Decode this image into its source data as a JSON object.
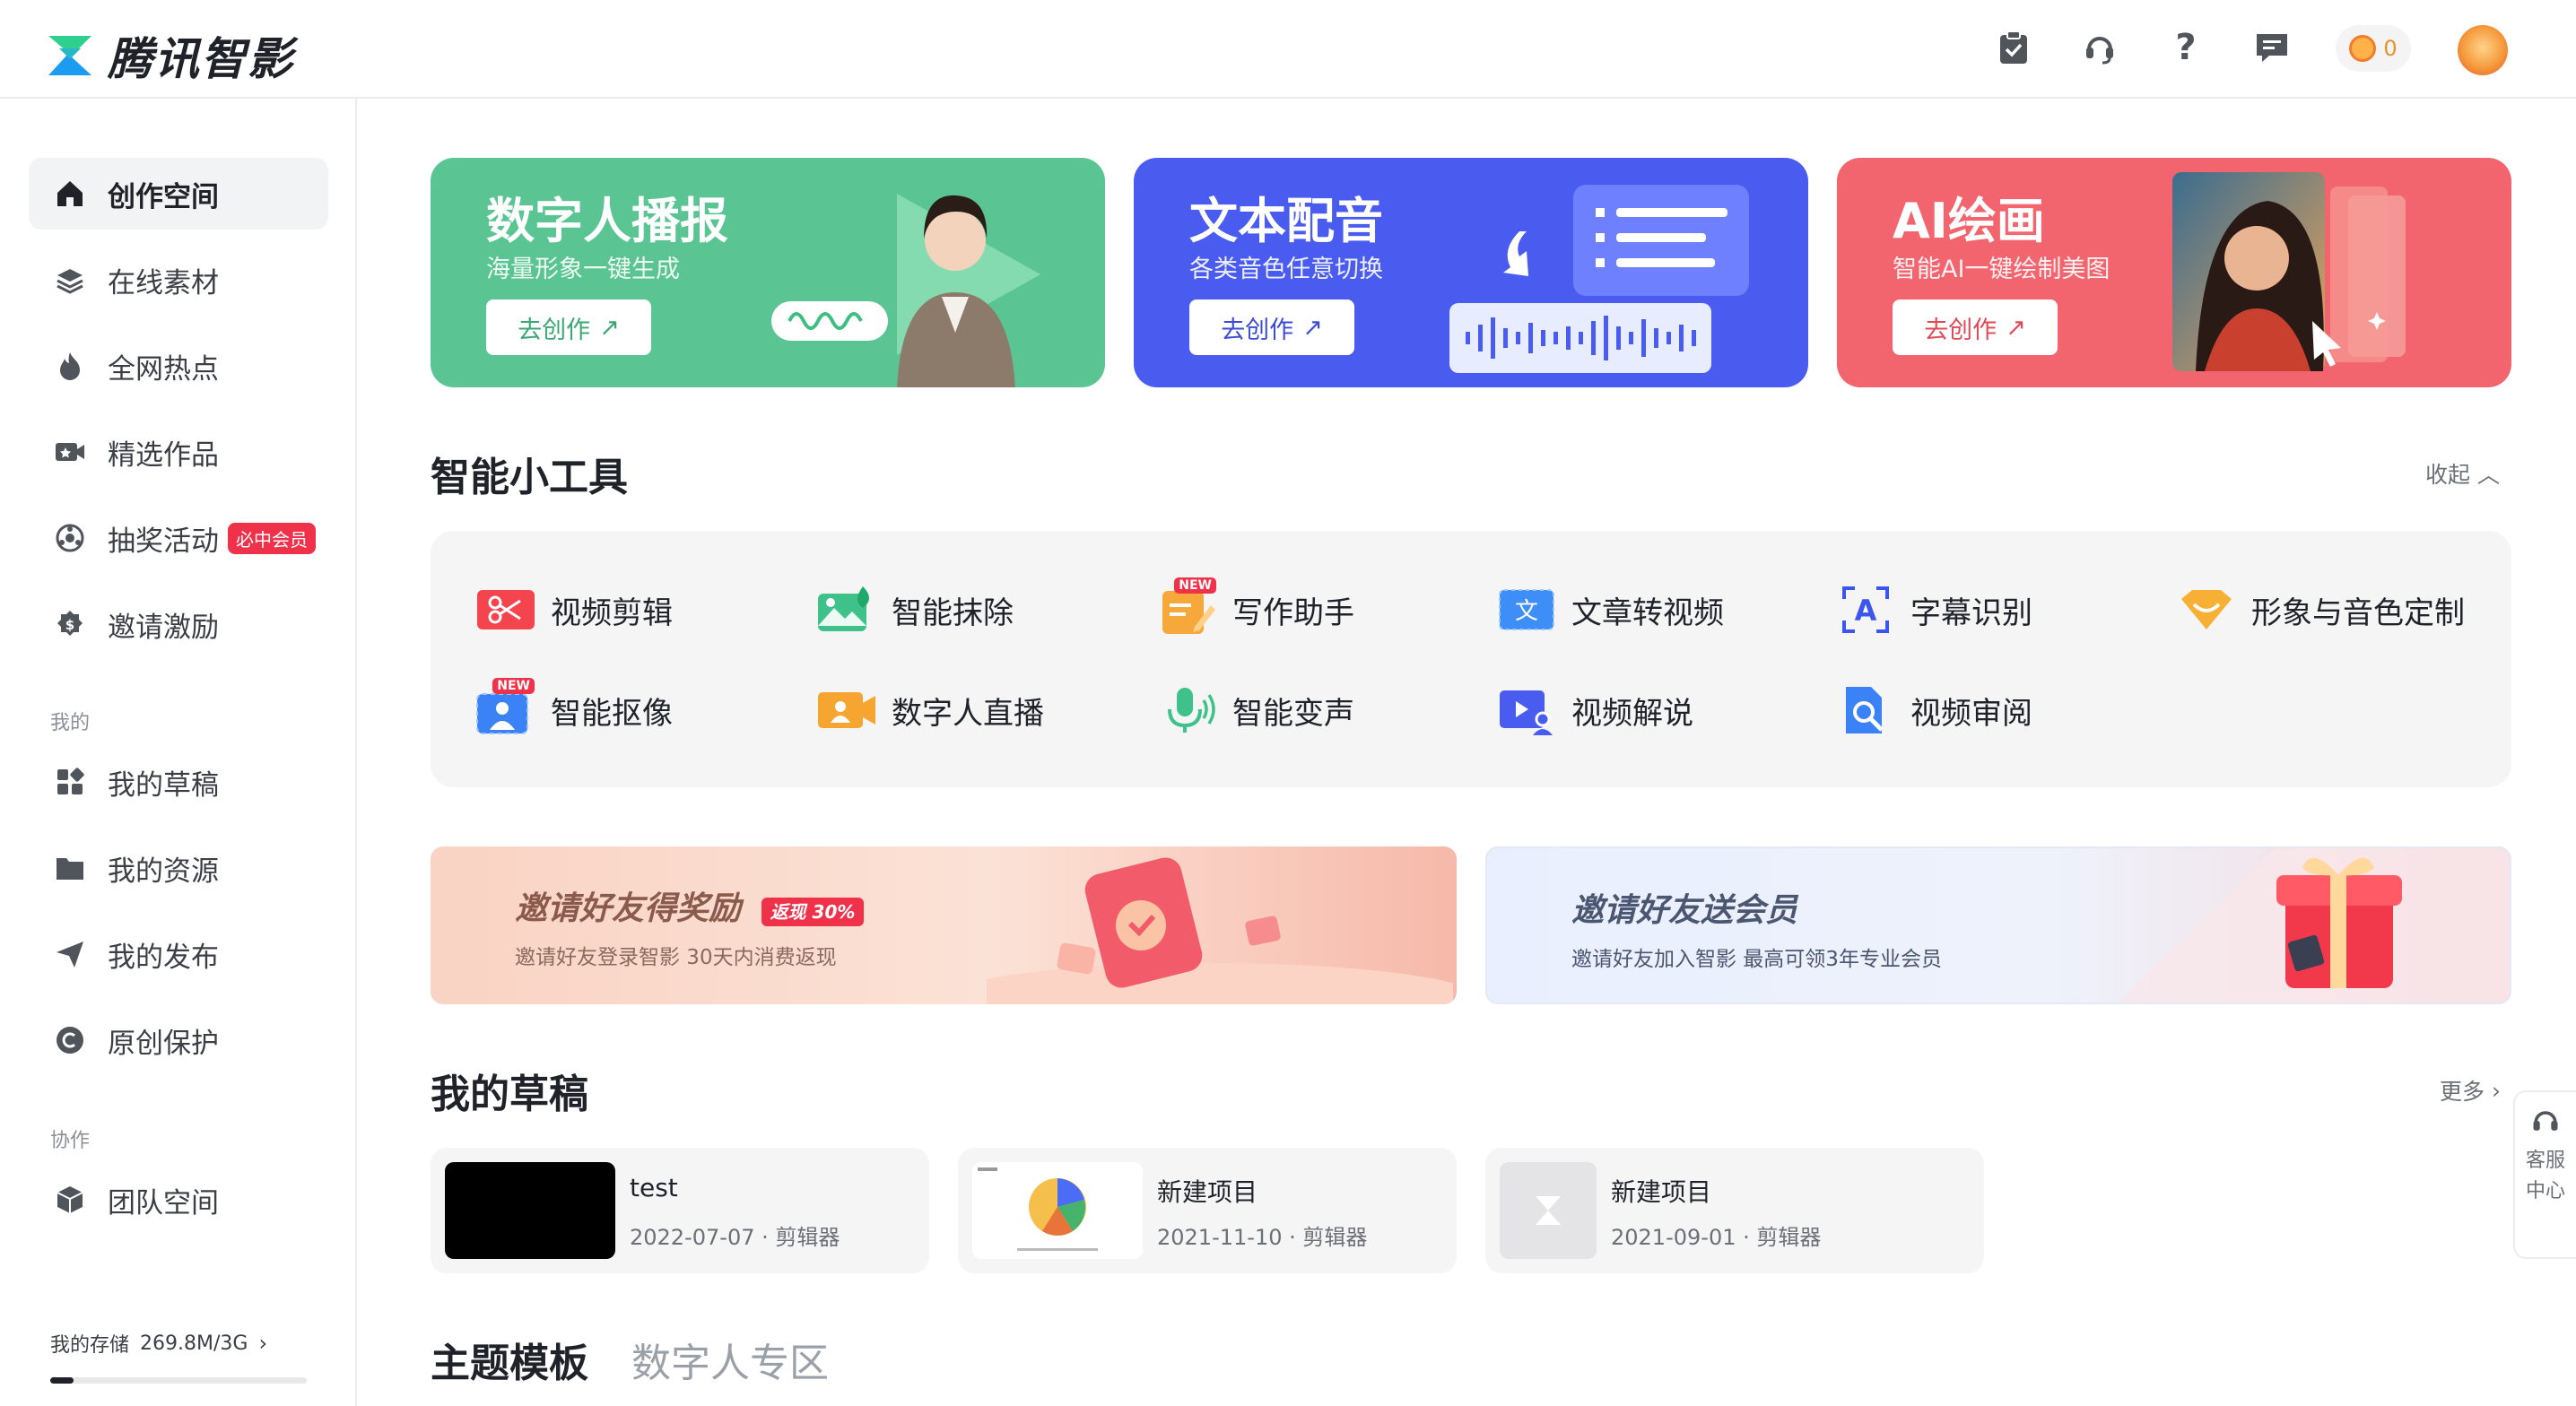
{
  "app": {
    "brand": "腾讯智影",
    "coins": "0"
  },
  "sidebar": {
    "items": [
      {
        "label": "创作空间"
      },
      {
        "label": "在线素材"
      },
      {
        "label": "全网热点"
      },
      {
        "label": "精选作品"
      },
      {
        "label": "抽奖活动",
        "badge": "必中会员"
      },
      {
        "label": "邀请激励"
      }
    ],
    "group_mine": "我的",
    "mine_items": [
      {
        "label": "我的草稿"
      },
      {
        "label": "我的资源"
      },
      {
        "label": "我的发布"
      },
      {
        "label": "原创保护"
      }
    ],
    "group_collab": "协作",
    "collab_items": [
      {
        "label": "团队空间"
      }
    ],
    "storage_label": "我的存储",
    "storage_value": "269.8M/3G",
    "storage_used_fraction": 0.09
  },
  "banners": [
    {
      "title": "数字人播报",
      "subtitle": "海量形象一键生成",
      "button": "去创作",
      "color": "#5ac593"
    },
    {
      "title": "文本配音",
      "subtitle": "各类音色任意切换",
      "button": "去创作",
      "color": "#4a5cf0"
    },
    {
      "title": "AI绘画",
      "subtitle": "智能AI一键绘制美图",
      "button": "去创作",
      "color": "#f2646e"
    }
  ],
  "tools_section": {
    "title": "智能小工具",
    "collapse": "收起",
    "tools": [
      {
        "label": "视频剪辑",
        "icon": "video-edit-icon"
      },
      {
        "label": "智能抹除",
        "icon": "erase-icon"
      },
      {
        "label": "写作助手",
        "icon": "writing-icon",
        "new": "NEW"
      },
      {
        "label": "文章转视频",
        "icon": "article-video-icon"
      },
      {
        "label": "字幕识别",
        "icon": "subtitle-icon"
      },
      {
        "label": "形象与音色定制",
        "icon": "custom-icon"
      },
      {
        "label": "智能抠像",
        "icon": "matting-icon",
        "new": "NEW"
      },
      {
        "label": "数字人直播",
        "icon": "live-icon"
      },
      {
        "label": "智能变声",
        "icon": "voice-change-icon"
      },
      {
        "label": "视频解说",
        "icon": "video-narrate-icon"
      },
      {
        "label": "视频审阅",
        "icon": "video-review-icon"
      }
    ]
  },
  "promos": [
    {
      "title": "邀请好友得奖励",
      "tag": "返现 30%",
      "subtitle": "邀请好友登录智影 30天内消费返现"
    },
    {
      "title": "邀请好友送会员",
      "subtitle": "邀请好友加入智影 最高可领3年专业会员"
    }
  ],
  "drafts_section": {
    "title": "我的草稿",
    "more": "更多",
    "drafts": [
      {
        "name": "test",
        "meta": "2022-07-07 · 剪辑器"
      },
      {
        "name": "新建项目",
        "meta": "2021-11-10 · 剪辑器"
      },
      {
        "name": "新建项目",
        "meta": "2021-09-01 · 剪辑器"
      }
    ]
  },
  "templates_section": {
    "tab_active": "主题模板",
    "tab_other": "数字人专区"
  },
  "support": {
    "label_line1": "客服",
    "label_line2": "中心"
  }
}
